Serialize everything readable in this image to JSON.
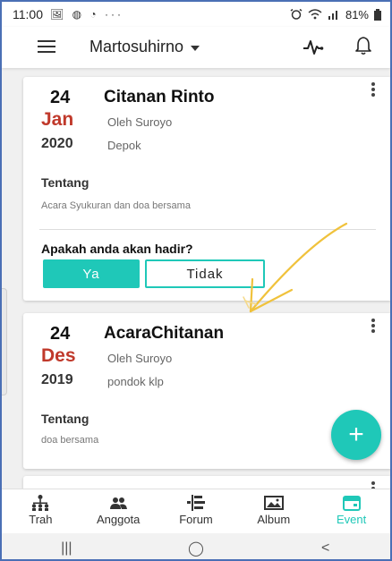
{
  "status_bar": {
    "time": "11:00",
    "left_icons": "🖼 ◍ ◔ ···",
    "battery": "81%"
  },
  "app_bar": {
    "group_name": "Martosuhirno"
  },
  "events": [
    {
      "day": "24",
      "month": "Jan",
      "year": "2020",
      "title": "Citanan Rinto",
      "by": "Oleh Suroyo",
      "place": "Depok",
      "about_label": "Tentang",
      "about_text": "Acara Syukuran dan doa bersama",
      "question": "Apakah anda akan hadir?",
      "yes_label": "Ya",
      "no_label": "Tidak"
    },
    {
      "day": "24",
      "month": "Des",
      "year": "2019",
      "title": "AcaraChitanan",
      "by": "Oleh Suroyo",
      "place": "pondok klp",
      "about_label": "Tentang",
      "about_text": "doa bersama"
    }
  ],
  "fab": {
    "label": "+"
  },
  "bottom_nav": [
    {
      "label": "Trah",
      "icon": "family-tree-icon"
    },
    {
      "label": "Anggota",
      "icon": "people-icon"
    },
    {
      "label": "Forum",
      "icon": "forum-icon"
    },
    {
      "label": "Album",
      "icon": "album-icon"
    },
    {
      "label": "Event",
      "icon": "calendar-icon",
      "active": true
    }
  ],
  "system_nav": {
    "recents": "|||",
    "home": "◯",
    "back": "<"
  },
  "colors": {
    "accent": "#1fc8b8",
    "month": "#c0392b",
    "frame": "#4a6fb5",
    "annotation_arrow": "#f0c23c"
  }
}
